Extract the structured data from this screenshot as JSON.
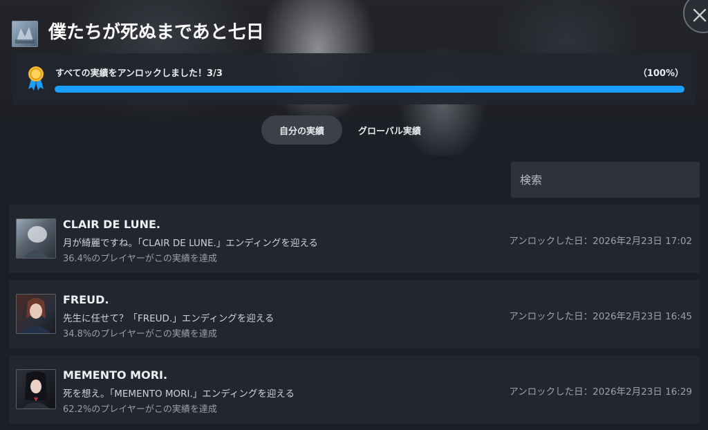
{
  "header": {
    "game_title": "僕たちが死ぬまであと七日"
  },
  "progress": {
    "label": "すべての実績をアンロックしました！3/3",
    "percent_text": "（100%）",
    "fraction": 1.0
  },
  "tabs": [
    {
      "label": "自分の実績",
      "active": true
    },
    {
      "label": "グローバル実績",
      "active": false
    }
  ],
  "search": {
    "placeholder": "検索"
  },
  "achievements": [
    {
      "title": "CLAIR DE LUNE.",
      "description": "月が綺麗ですね。「CLAIR DE LUNE.」エンディングを迎える",
      "global_pct": "36.4%のプレイヤーがこの実績を達成",
      "unlocked": "アンロックした日：2026年2月23日 17:02"
    },
    {
      "title": "FREUD.",
      "description": "先生に任せて？「FREUD.」エンディングを迎える",
      "global_pct": "34.8%のプレイヤーがこの実績を達成",
      "unlocked": "アンロックした日：2026年2月23日 16:45"
    },
    {
      "title": "MEMENTO MORI.",
      "description": "死を想え。「MEMENTO MORI.」エンディングを迎える",
      "global_pct": "62.2%のプレイヤーがこの実績を達成",
      "unlocked": "アンロックした日：2026年2月23日 16:29"
    }
  ],
  "icons": {
    "close": "close-icon",
    "medal": "medal-icon"
  },
  "colors": {
    "accent": "#1a9fff",
    "background": "#1b1f27",
    "row": "#22262e"
  }
}
